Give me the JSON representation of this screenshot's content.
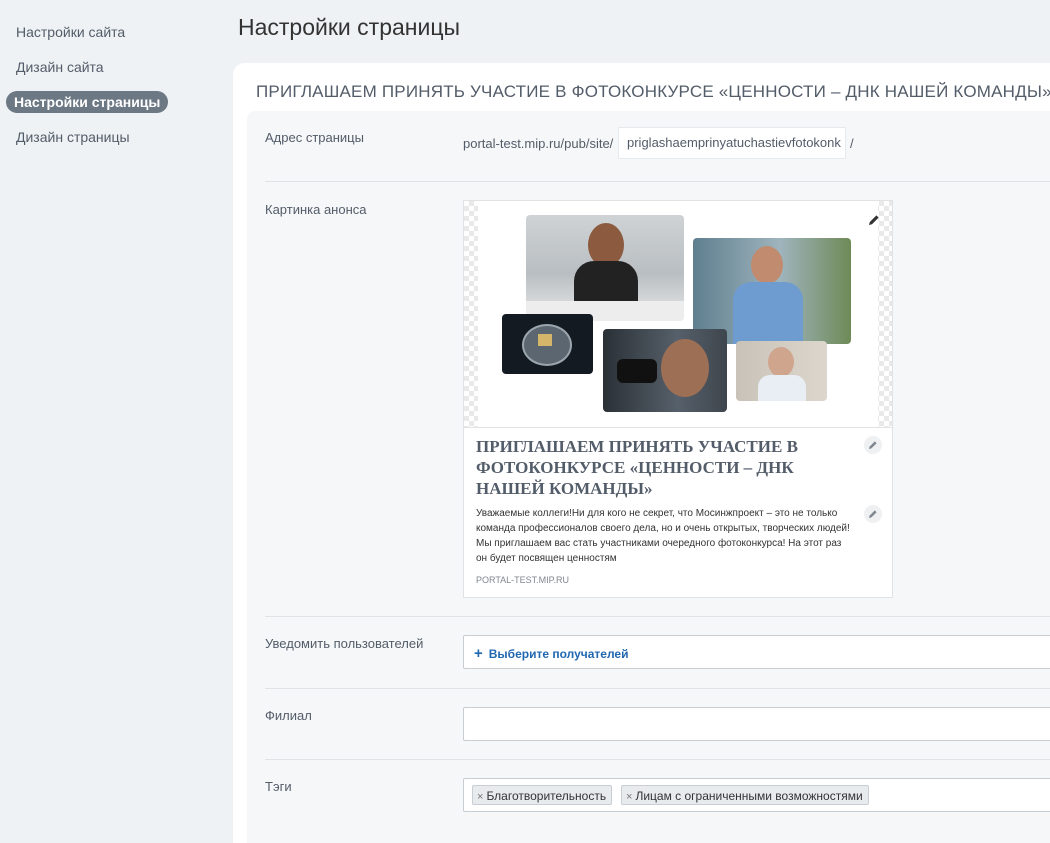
{
  "sidebar": {
    "items": [
      {
        "label": "Настройки сайта"
      },
      {
        "label": "Дизайн сайта"
      },
      {
        "label": "Настройки страницы",
        "active": true
      },
      {
        "label": "Дизайн страницы"
      }
    ]
  },
  "page": {
    "title": "Настройки страницы",
    "heading": "ПРИГЛАШАЕМ ПРИНЯТЬ УЧАСТИЕ В ФОТОКОНКУРСЕ «ЦЕННОСТИ – ДНК НАШЕЙ КОМАНДЫ»"
  },
  "address": {
    "label": "Адрес страницы",
    "prefix": "portal-test.mip.ru/pub/site/",
    "value": "priglashaemprinyatuchastievfotokonk",
    "suffix": "/"
  },
  "preview": {
    "label": "Картинка анонса",
    "title": "ПРИГЛАШАЕМ ПРИНЯТЬ УЧАСТИЕ В ФОТОКОНКУРСЕ «ЦЕННОСТИ – ДНК НАШЕЙ КОМАНДЫ»",
    "description": "Уважаемые коллеги!Ни для кого не секрет, что Мосинжпроект – это не только команда профессионалов своего дела, но и очень открытых, творческих людей! Мы приглашаем вас стать участниками очередного фотоконкурса! На этот раз он будет посвящен ценностям",
    "domain": "PORTAL-TEST.MIP.RU"
  },
  "notify": {
    "label": "Уведомить пользователей",
    "plus": "+",
    "button": "Выберите получателей"
  },
  "branch": {
    "label": "Филиал",
    "value": ""
  },
  "tags": {
    "label": "Тэги",
    "items": [
      {
        "remove": "×",
        "label": "Благотворительность"
      },
      {
        "remove": "×",
        "label": "Лицам с ограниченными возможностями"
      }
    ]
  },
  "colors": {
    "accent": "#2067b0",
    "sidebar_active": "#6d7885",
    "text_muted": "#535c69"
  },
  "icons": [
    "pencil-icon",
    "plus-icon",
    "remove-tag-icon"
  ]
}
